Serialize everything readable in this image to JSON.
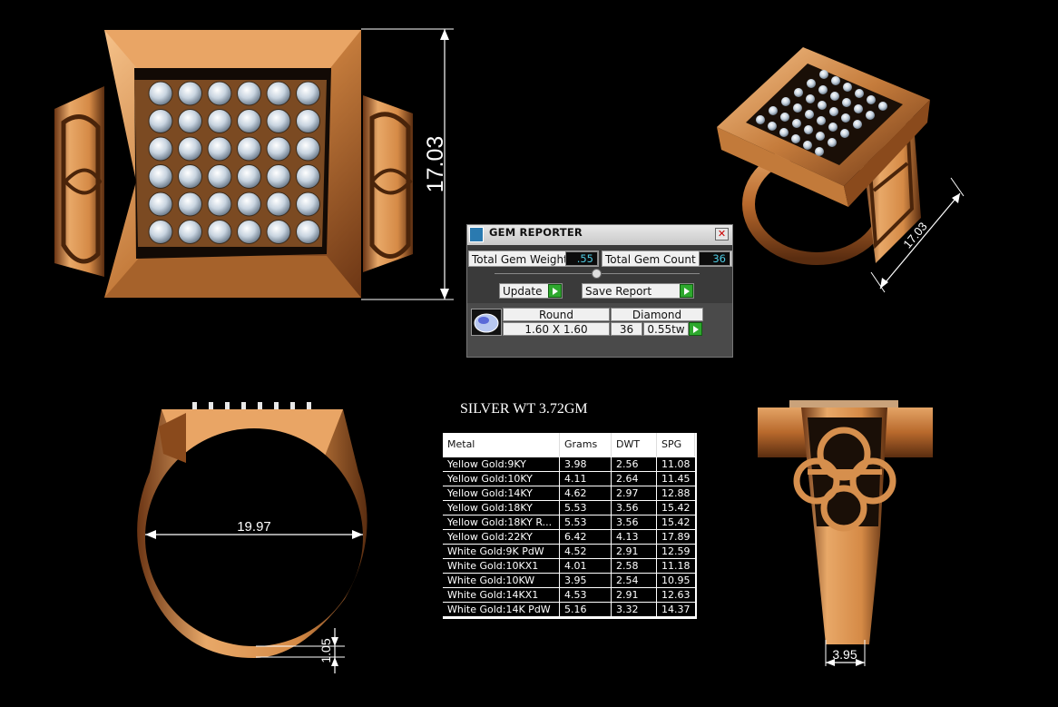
{
  "dimensions": {
    "top_height": "17.03",
    "persp_height": "17.03",
    "inner_diameter": "19.97",
    "shank_thickness": "1.05",
    "shank_width": "3.95"
  },
  "silver_weight": "SILVER WT 3.72GM",
  "gem_reporter": {
    "title": "GEM REPORTER",
    "close_glyph": "✕",
    "total_weight_label": "Total Gem Weight",
    "total_weight_value": ".55",
    "total_count_label": "Total Gem Count",
    "total_count_value": "36",
    "update_label": "Update",
    "save_report_label": "Save Report",
    "gem_row": {
      "shape": "Round",
      "type": "Diamond",
      "size": "1.60 X 1.60",
      "count": "36",
      "weight": "0.55tw"
    }
  },
  "metal_table": {
    "columns": [
      "Metal",
      "Grams",
      "DWT",
      "SPG"
    ],
    "rows": [
      [
        "Yellow Gold:9KY",
        "3.98",
        "2.56",
        "11.08"
      ],
      [
        "Yellow Gold:10KY",
        "4.11",
        "2.64",
        "11.45"
      ],
      [
        "Yellow Gold:14KY",
        "4.62",
        "2.97",
        "12.88"
      ],
      [
        "Yellow Gold:18KY",
        "5.53",
        "3.56",
        "15.42"
      ],
      [
        "Yellow Gold:18KY R...",
        "5.53",
        "3.56",
        "15.42"
      ],
      [
        "Yellow Gold:22KY",
        "6.42",
        "4.13",
        "17.89"
      ],
      [
        "White Gold:9K PdW",
        "4.52",
        "2.91",
        "12.59"
      ],
      [
        "White Gold:10KX1",
        "4.01",
        "2.58",
        "11.18"
      ],
      [
        "White Gold:10KW",
        "3.95",
        "2.54",
        "10.95"
      ],
      [
        "White Gold:14KX1",
        "4.53",
        "2.91",
        "12.63"
      ],
      [
        "White Gold:14K PdW",
        "5.16",
        "3.32",
        "14.37"
      ]
    ]
  },
  "colors": {
    "gold_light": "#f0b27a",
    "gold_mid": "#c57c3c",
    "gold_dark": "#5a2d10",
    "value_cyan": "#4ec9e0"
  }
}
